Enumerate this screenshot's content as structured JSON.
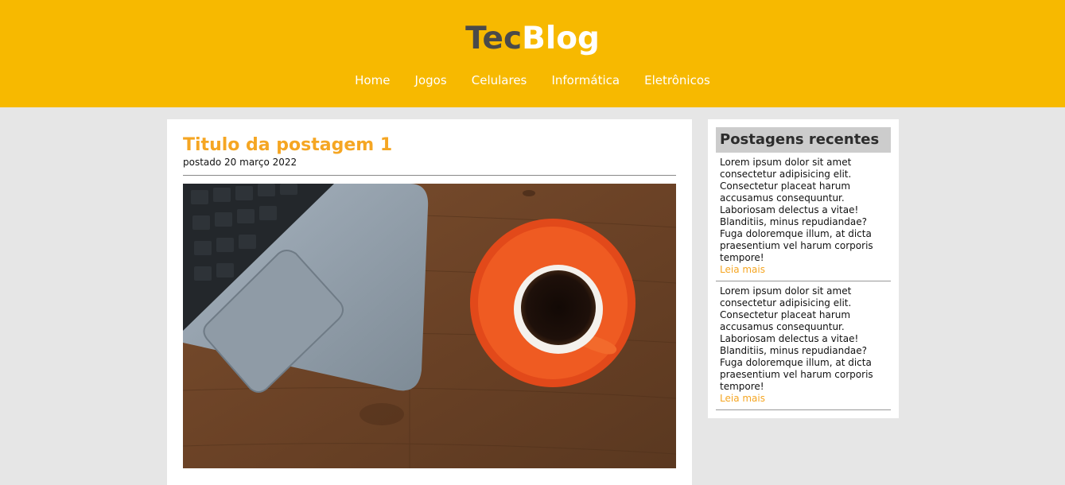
{
  "brand": {
    "part1": "Tec",
    "part2": "Blog"
  },
  "nav": [
    {
      "label": "Home"
    },
    {
      "label": "Jogos"
    },
    {
      "label": "Celulares"
    },
    {
      "label": "Informática"
    },
    {
      "label": "Eletrônicos"
    }
  ],
  "post": {
    "title": "Titulo da postagem 1",
    "date": "postado 20 março 2022"
  },
  "sidebar": {
    "title": "Postagens recentes",
    "items": [
      {
        "text": "Lorem ipsum dolor sit amet consectetur adipisicing elit. Consectetur placeat harum accusamus consequuntur. Laboriosam delectus a vitae! Blanditiis, minus repudiandae? Fuga doloremque illum, at dicta praesentium vel harum corporis tempore!",
        "link": "Leia mais"
      },
      {
        "text": "Lorem ipsum dolor sit amet consectetur adipisicing elit. Consectetur placeat harum accusamus consequuntur. Laboriosam delectus a vitae! Blanditiis, minus repudiandae? Fuga doloremque illum, at dicta praesentium vel harum corporis tempore!",
        "link": "Leia mais"
      }
    ]
  },
  "colors": {
    "header": "#f7b900",
    "accent": "#f5a623",
    "background": "#e6e6e6"
  }
}
